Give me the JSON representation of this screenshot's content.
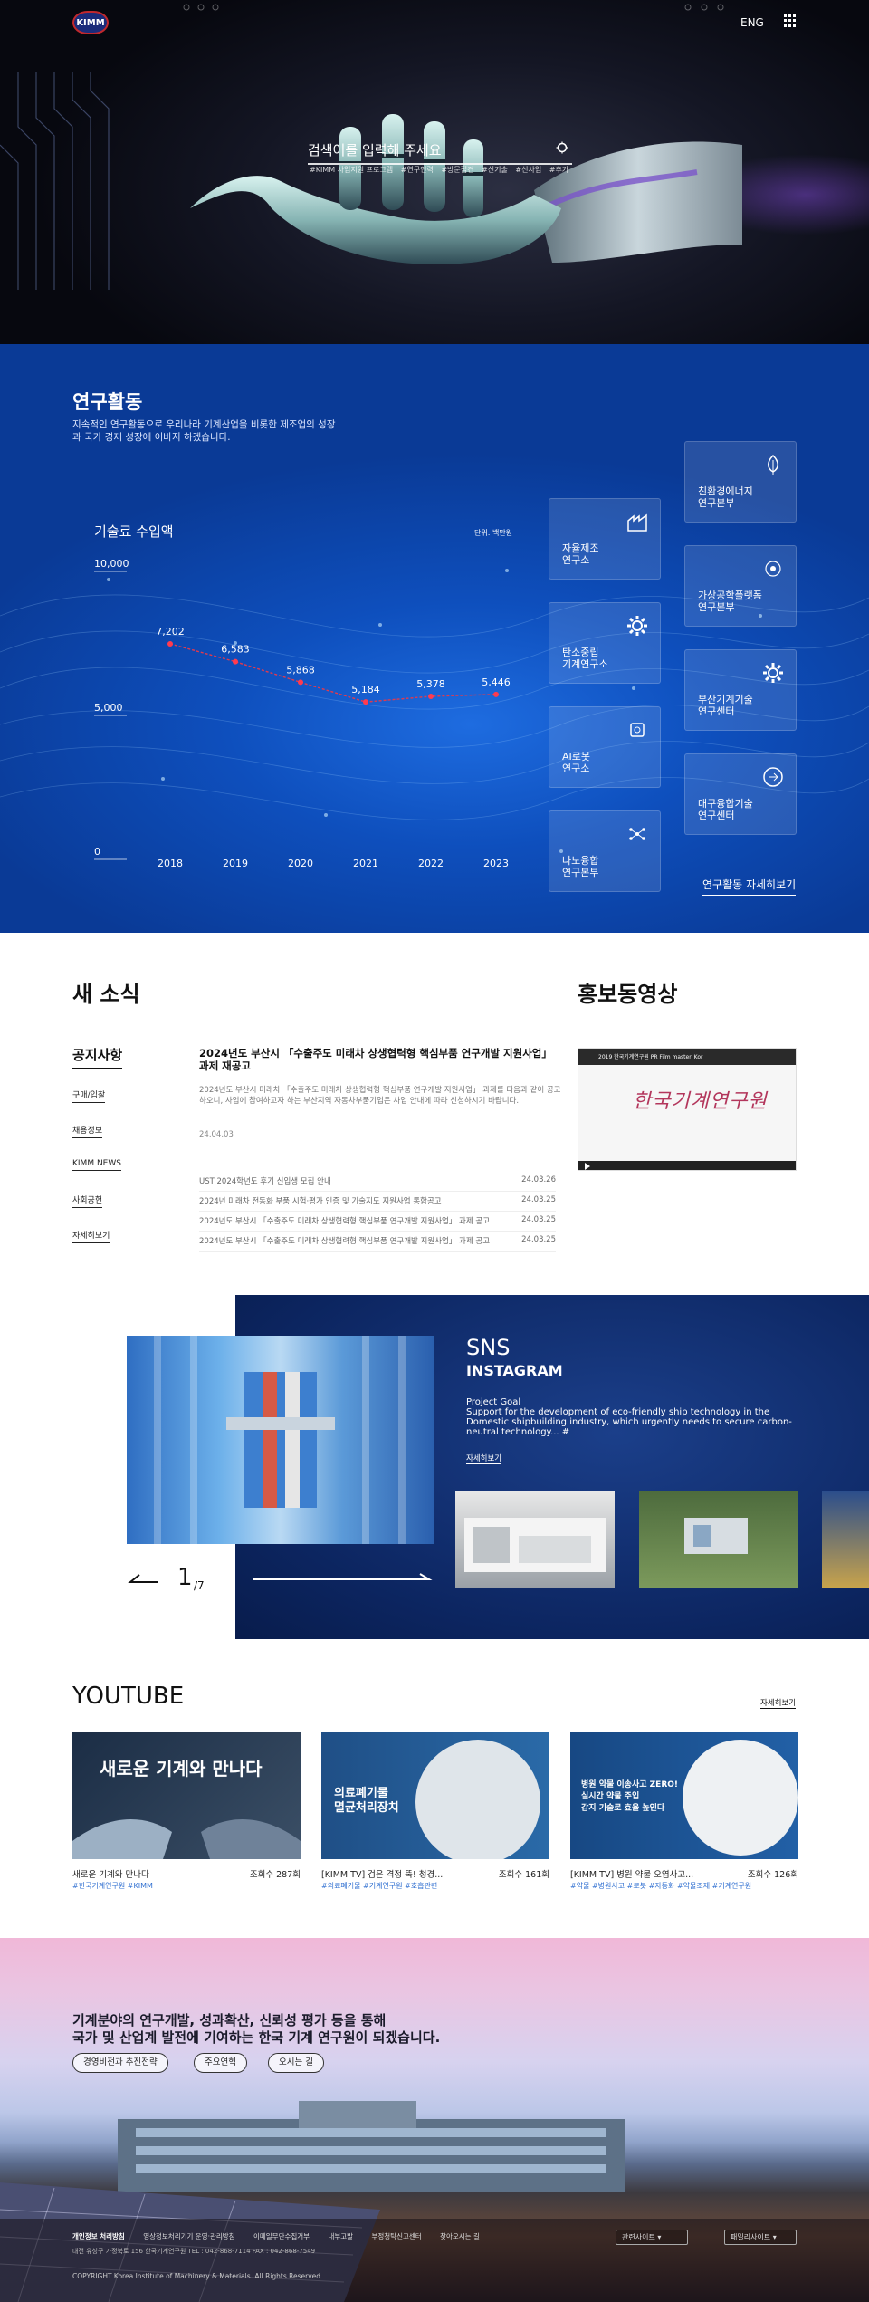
{
  "header": {
    "logo_text": "KIMM",
    "lang_label": "ENG",
    "search_placeholder": "검색어를 입력해 주세요",
    "hashtags": [
      "#KIMM 사업지원 프로그램",
      "#연구인력",
      "#방문접견",
      "#신기술",
      "#신사업",
      "#추가"
    ]
  },
  "research": {
    "title": "연구활동",
    "subtitle": "지속적인 연구활동으로 우리나라 기계산업을 비롯한 제조업의 성장과 국가 경제 성장에 이바지 하겠습니다.",
    "chart_title": "기술료 수입액",
    "chart_unit": "단위: 백만원",
    "units": [
      {
        "label": "자율제조\n연구소",
        "icon": "factory-icon"
      },
      {
        "label": "탄소중립\n기계연구소",
        "icon": "gear-icon"
      },
      {
        "label": "AI로봇\n연구소",
        "icon": "robot-icon"
      },
      {
        "label": "나노융합\n연구본부",
        "icon": "nano-icon"
      },
      {
        "label": "친환경에너지\n연구본부",
        "icon": "leaf-icon"
      },
      {
        "label": "가상공학플랫폼\n연구본부",
        "icon": "platform-icon"
      },
      {
        "label": "부산기계기술\n연구센터",
        "icon": "gear-icon"
      },
      {
        "label": "대구융합기술\n연구센터",
        "icon": "convergence-icon"
      }
    ],
    "more_label": "연구활동 자세히보기"
  },
  "chart_data": {
    "type": "line",
    "title": "기술료 수입액",
    "unit": "단위: 백만원",
    "categories": [
      "2018",
      "2019",
      "2020",
      "2021",
      "2022",
      "2023"
    ],
    "values": [
      7202,
      6583,
      5868,
      5184,
      5378,
      5446
    ],
    "value_labels": [
      "7,202",
      "6,583",
      "5,868",
      "5,184",
      "5,378",
      "5,446"
    ],
    "y_ticks": [
      "10,000",
      "5,000",
      "0"
    ],
    "ylim": [
      0,
      10000
    ]
  },
  "news": {
    "title": "새 소식",
    "notice_title": "공지사항",
    "side_links": [
      "구매/입찰",
      "채용정보",
      "KIMM NEWS",
      "사회공헌",
      "자세히보기"
    ],
    "featured_title": "2024년도 부산시 「수출주도 미래차 상생협력형 핵심부품 연구개발 지원사업」 과제 재공고",
    "featured_desc": "2024년도 부산시 미래차 「수출주도 미래차 상생협력형 핵심부품 연구개발 지원사업」 과제를 다음과 같이 공고하오니, 사업에 참여하고자 하는 부산지역 자동차부품기업은 사업 안내에 따라 신청하시기 바랍니다.",
    "featured_date": "24.04.03",
    "rows": [
      {
        "title": "UST 2024학년도 후기 신입생 모집 안내",
        "date": "24.03.26"
      },
      {
        "title": "2024년 미래차 전동화 부품 시험·평가 인증 및 기술지도 지원사업 통합공고",
        "date": "24.03.25"
      },
      {
        "title": "2024년도 부산시 「수출주도 미래차 상생협력형 핵심부품 연구개발 지원사업」 과제 공고",
        "date": "24.03.25"
      },
      {
        "title": "2024년도 부산시 「수출주도 미래차 상생협력형 핵심부품 연구개발 지원사업」 과제 공고",
        "date": "24.03.25"
      }
    ]
  },
  "promo": {
    "title": "홍보동영상",
    "video_caption": "2019 한국기계연구원 PR Film master_Kor",
    "video_logo_text": "한국기계연구원"
  },
  "sns": {
    "title": "SNS",
    "platform": "INSTAGRAM",
    "post_heading": "Project Goal",
    "post_text": "Support for the development of eco-friendly ship technology in the Domestic shipbuilding industry, which urgently needs to secure carbon-neutral technology... #",
    "more_label": "자세히보기",
    "page_current": "1",
    "page_total": "7"
  },
  "youtube": {
    "title": "YOUTUBE",
    "more_label": "자세히보기",
    "videos": [
      {
        "caption": "새로운 기계와 만나다",
        "views": "조회수 287회",
        "tags": "#한국기계연구원 #KIMM",
        "thumb_text": "새로운 기계와 만나다"
      },
      {
        "caption": "[KIMM TV] 검은 격정 뚝! 청경...",
        "views": "조회수 161회",
        "tags": "#의료폐기물 #기계연구원 #호흡관련",
        "thumb_text": "의료폐기물\n멸균처리장치"
      },
      {
        "caption": "[KIMM TV] 병원 약물 오염사고...",
        "views": "조회수 126회",
        "tags": "#약물 #병원사고 #로봇 #자동화 #약물조제 #기계연구원",
        "thumb_text": "병원 약물 이송사고 ZERO!\n실시간 약물 주입\n감지 기술로 효율 높인다"
      }
    ]
  },
  "footer": {
    "slogan_line1": "기계분야의 연구개발, 성과확산, 신뢰성 평가 등을 통해",
    "slogan_line2": "국가 및 산업계 발전에 기여하는 한국 기계 연구원이 되겠습니다.",
    "buttons": [
      "경영비전과 추진전략",
      "주요연혁",
      "오시는 길"
    ],
    "links": [
      "개인정보 처리방침",
      "영상정보처리기기 운영·관리방침",
      "이메일무단수집거부",
      "내부고발",
      "부정청탁신고센터",
      "찾아오시는 길"
    ],
    "address": "대전 유성구 가정북로 156 한국기계연구원  TEL : 042-868-7114  FAX : 042-868-7549",
    "copyright": "COPYRIGHT Korea Institute of Machinery & Materials. All Rights Reserved.",
    "select1": "관련사이트",
    "select2": "패밀리사이트"
  }
}
